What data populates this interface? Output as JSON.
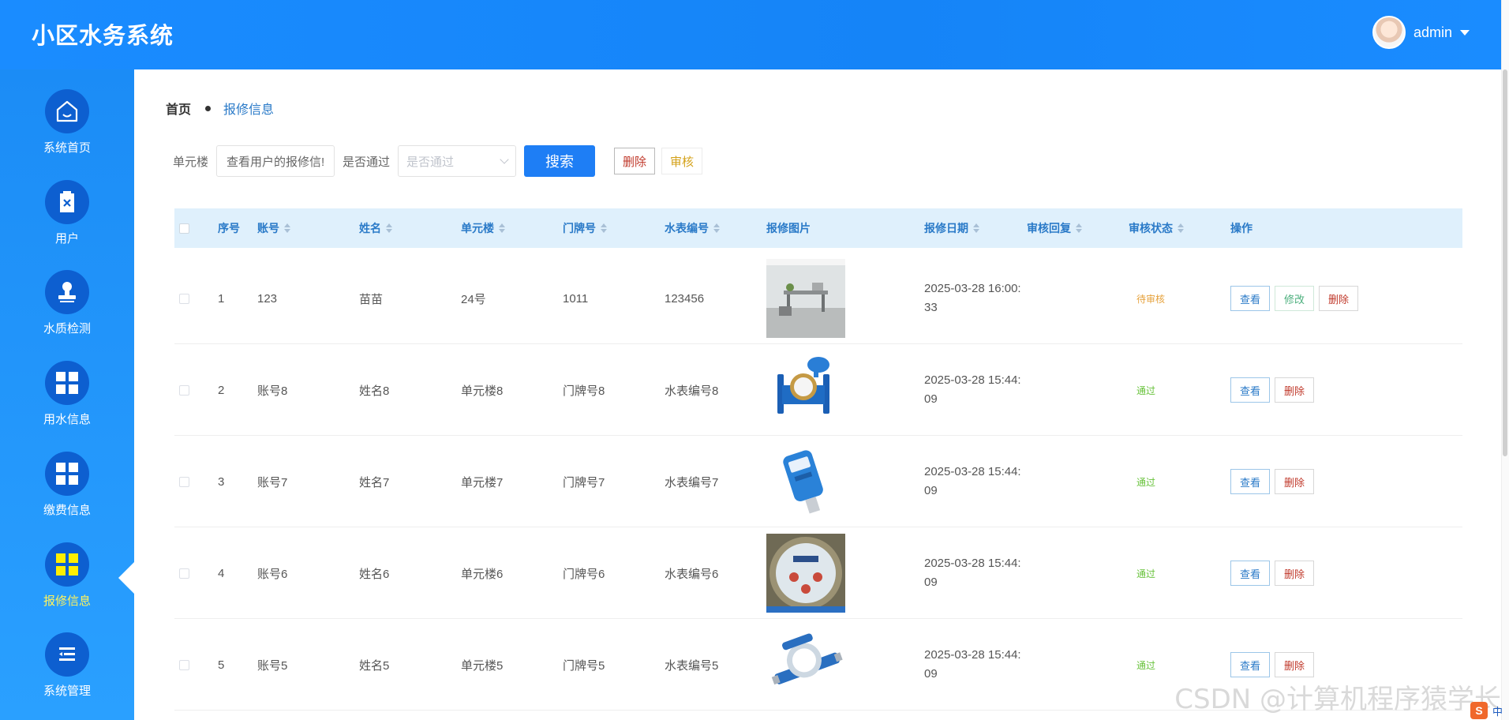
{
  "app": {
    "title": "小区水务系统"
  },
  "user": {
    "name": "admin"
  },
  "sidebar": {
    "items": [
      {
        "label": "系统首页",
        "icon": "home-icon"
      },
      {
        "label": "用户",
        "icon": "clipboard-x-icon"
      },
      {
        "label": "水质检测",
        "icon": "stamp-icon"
      },
      {
        "label": "用水信息",
        "icon": "grid-icon"
      },
      {
        "label": "缴费信息",
        "icon": "grid-icon"
      },
      {
        "label": "报修信息",
        "icon": "grid-icon",
        "active": true
      },
      {
        "label": "系统管理",
        "icon": "menu-list-icon"
      }
    ]
  },
  "breadcrumb": {
    "home": "首页",
    "current": "报修信息"
  },
  "filters": {
    "unit_label": "单元楼",
    "unit_value": "查看用户的报修信!",
    "pass_label": "是否通过",
    "pass_placeholder": "是否通过",
    "search_button": "搜索",
    "delete_button": "删除",
    "audit_button": "审核"
  },
  "table": {
    "columns": [
      "序号",
      "账号",
      "姓名",
      "单元楼",
      "门牌号",
      "水表编号",
      "报修图片",
      "报修日期",
      "审核回复",
      "审核状态",
      "操作"
    ],
    "rows": [
      {
        "index": "1",
        "account": "123",
        "name": "苗苗",
        "unit": "24号",
        "door": "1011",
        "meter": "123456",
        "image": "office-photo",
        "date1": "2025-03-28 16:00:",
        "date2": "33",
        "reply": "",
        "status": "待审核",
        "status_type": "pending",
        "actions": [
          "查看",
          "修改",
          "删除"
        ]
      },
      {
        "index": "2",
        "account": "账号8",
        "name": "姓名8",
        "unit": "单元楼8",
        "door": "门牌号8",
        "meter": "水表编号8",
        "image": "blue-flange-meter",
        "date1": "2025-03-28 15:44:",
        "date2": "09",
        "reply": "",
        "status": "通过",
        "status_type": "pass",
        "actions": [
          "查看",
          "删除"
        ]
      },
      {
        "index": "3",
        "account": "账号7",
        "name": "姓名7",
        "unit": "单元楼7",
        "door": "门牌号7",
        "meter": "水表编号7",
        "image": "smart-meter",
        "date1": "2025-03-28 15:44:",
        "date2": "09",
        "reply": "",
        "status": "通过",
        "status_type": "pass",
        "actions": [
          "查看",
          "删除"
        ]
      },
      {
        "index": "4",
        "account": "账号6",
        "name": "姓名6",
        "unit": "单元楼6",
        "door": "门牌号6",
        "meter": "水表编号6",
        "image": "dial-meter",
        "date1": "2025-03-28 15:44:",
        "date2": "09",
        "reply": "",
        "status": "通过",
        "status_type": "pass",
        "actions": [
          "查看",
          "删除"
        ]
      },
      {
        "index": "5",
        "account": "账号5",
        "name": "姓名5",
        "unit": "单元楼5",
        "door": "门牌号5",
        "meter": "水表编号5",
        "image": "blue-meter",
        "date1": "2025-03-28 15:44:",
        "date2": "09",
        "reply": "",
        "status": "通过",
        "status_type": "pass",
        "actions": [
          "查看",
          "删除"
        ]
      }
    ]
  },
  "watermark": "CSDN @计算机程序猿学长",
  "ime": {
    "logo": "S",
    "label": "中"
  },
  "colors": {
    "header": "#1a8cff",
    "sidebar": "#1b8cf6",
    "nav_circle": "#0d5fd0",
    "active_label": "#fff35c",
    "primary_button": "#1e7ef5",
    "pass": "#67c23a",
    "pending": "#e6a23c"
  }
}
